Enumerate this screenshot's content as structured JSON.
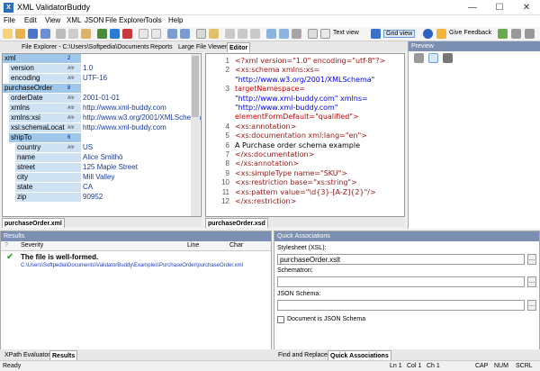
{
  "window": {
    "title": "XML ValidatorBuddy",
    "icon": "app-icon",
    "minimize": "—",
    "maximize": "☐",
    "close": "✕"
  },
  "menu": [
    "File",
    "Edit",
    "View",
    "XML",
    "JSON",
    "File Explorer",
    "Tools",
    "Help"
  ],
  "toolbar": {
    "text_view": "Text view",
    "grid_view": "Grid view",
    "give_feedback": "Give Feedback"
  },
  "tabs": [
    "File Explorer - C:\\Users\\Softpedia\\Documents",
    "Reports",
    "Large File Viewer",
    "Editor"
  ],
  "grid": {
    "rows": [
      {
        "key": "xml",
        "extra": "2",
        "value": "",
        "node": true,
        "indent": 0
      },
      {
        "key": "version",
        "extra": "Attr",
        "value": "1.0",
        "node": false,
        "indent": 1
      },
      {
        "key": "encoding",
        "extra": "Attr",
        "value": "UTF-16",
        "node": false,
        "indent": 1
      },
      {
        "key": "purchaseOrder",
        "extra": "8",
        "value": "",
        "node": true,
        "indent": 0
      },
      {
        "key": "orderDate",
        "extra": "Attr",
        "value": "2001-01-01",
        "node": false,
        "indent": 1
      },
      {
        "key": "xmlns",
        "extra": "Attr",
        "value": "http://www.xml-buddy.com",
        "node": false,
        "indent": 1
      },
      {
        "key": "xmlns:xsi",
        "extra": "Attr",
        "value": "http://www.w3.org/2001/XMLSchema",
        "node": false,
        "indent": 1
      },
      {
        "key": "xsi:schemaLocat",
        "extra": "Attr",
        "value": "http://www.xml-buddy.com",
        "node": false,
        "indent": 1
      },
      {
        "key": "shipTo",
        "extra": "6",
        "value": "",
        "node": true,
        "indent": 1
      },
      {
        "key": "country",
        "extra": "Attr",
        "value": "US",
        "node": false,
        "indent": 2
      },
      {
        "key": "name",
        "extra": "",
        "value": "Alice Smithö",
        "node": false,
        "indent": 2
      },
      {
        "key": "street",
        "extra": "",
        "value": "125 Maple Street",
        "node": false,
        "indent": 2
      },
      {
        "key": "city",
        "extra": "",
        "value": "Mill Valley",
        "node": false,
        "indent": 2
      },
      {
        "key": "state",
        "extra": "",
        "value": "CA",
        "node": false,
        "indent": 2
      },
      {
        "key": "zip",
        "extra": "",
        "value": "90952",
        "node": false,
        "indent": 2
      }
    ],
    "tab": "purchaseOrder.xml"
  },
  "xml": {
    "tab": "purchaseOrder.xsd",
    "lines": [
      {
        "n": "1",
        "t": "<?xml version=\"1.0\" encoding=\"utf-8\"?>"
      },
      {
        "n": "2",
        "t": "<xs:schema xmlns:xs="
      },
      {
        "n": "",
        "t": "\"http://www.w3.org/2001/XMLSchema\""
      },
      {
        "n": "3",
        "t": "targetNamespace="
      },
      {
        "n": "",
        "t": "\"http://www.xml-buddy.com\" xmlns="
      },
      {
        "n": "",
        "t": "\"http://www.xml-buddy.com\""
      },
      {
        "n": "",
        "t": "elementFormDefault=\"qualified\">"
      },
      {
        "n": "4",
        "t": "  <xs:annotation>"
      },
      {
        "n": "5",
        "t": "    <xs:documentation xml:lang=\"en\">"
      },
      {
        "n": "6",
        "t": "        A Purchase order schema example"
      },
      {
        "n": "7",
        "t": "    </xs:documentation>"
      },
      {
        "n": "8",
        "t": "  </xs:annotation>"
      },
      {
        "n": "9",
        "t": "  <xs:simpleType name=\"SKU\">"
      },
      {
        "n": "10",
        "t": "    <xs:restriction base=\"xs:string\">"
      },
      {
        "n": "11",
        "t": "      <xs:pattern value=\"\\d{3}-[A-Z]{2}\"/>"
      },
      {
        "n": "12",
        "t": "    </xs:restriction>"
      }
    ]
  },
  "preview": {
    "title": "Preview"
  },
  "results": {
    "title": "Results",
    "cols": [
      "Severity",
      "Line",
      "Char"
    ],
    "message": "The file is well-formed.",
    "path": "C:\\Users\\Softpedia\\Documents\\ValidatorBuddy\\Examples\\PurchaseOrder\\purchaseOrder.xml"
  },
  "quick": {
    "title": "Quick Associations",
    "stylesheet_label": "Stylesheet (XSL):",
    "stylesheet_value": "purchaseOrder.xslt",
    "schematron_label": "Schematron:",
    "json_label": "JSON Schema:",
    "checkbox": "Document is JSON Schema"
  },
  "bottom_tabs": [
    "XPath Evaluator",
    "Results",
    "Find and Replace",
    "Quick Associations"
  ],
  "status": {
    "left": "Ready",
    "ln": "Ln 1",
    "col": "Col 1",
    "ch": "Ch 1",
    "caps": "CAP",
    "num": "NUM",
    "scrl": "SCRL"
  }
}
